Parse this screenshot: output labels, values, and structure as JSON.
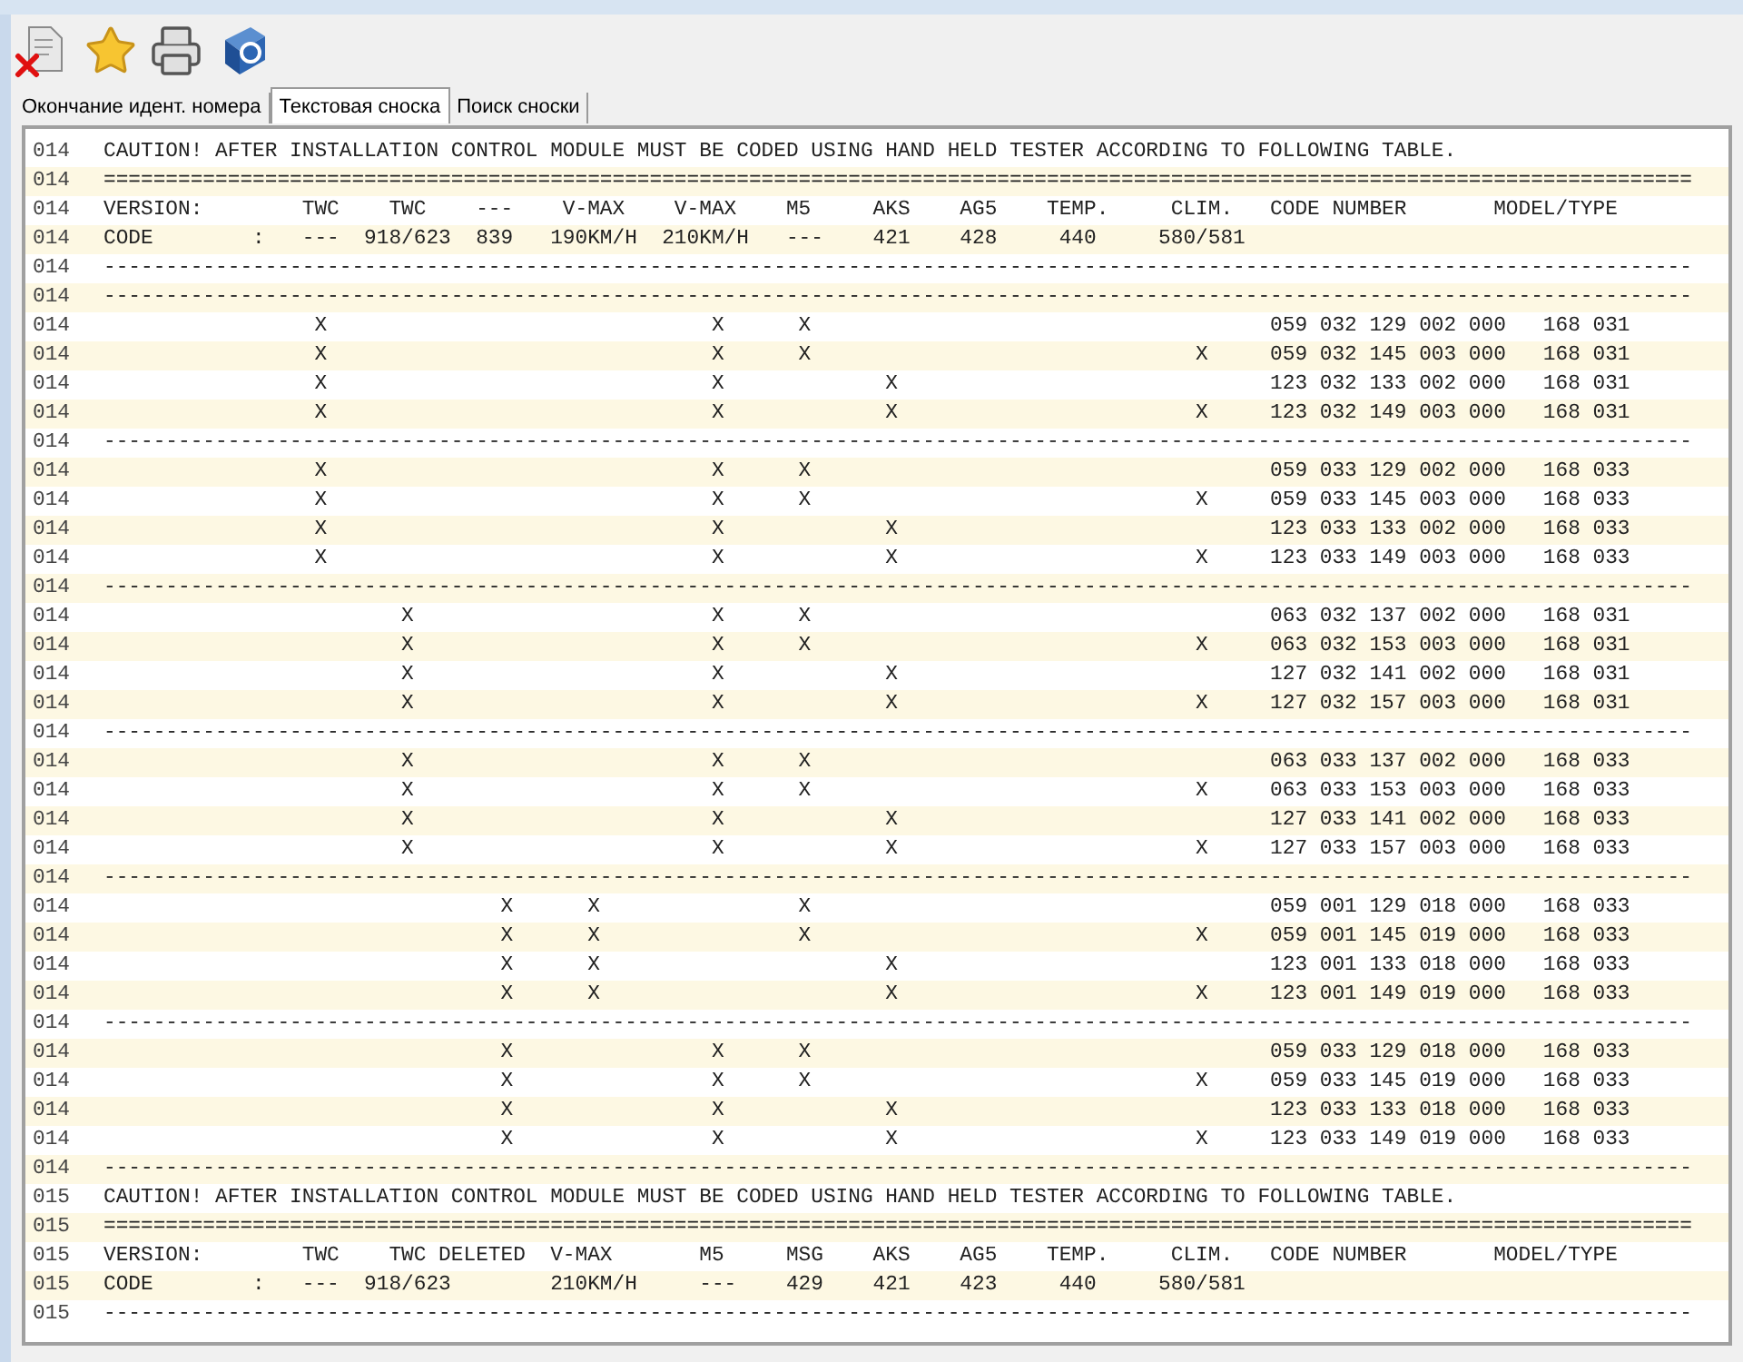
{
  "tabs": [
    {
      "label": "Окончание идент. номера",
      "selected": false
    },
    {
      "label": "Текстовая сноска",
      "selected": true
    },
    {
      "label": "Поиск сноски",
      "selected": false
    }
  ],
  "lines": [
    {
      "num": "014",
      "text": "CAUTION! AFTER INSTALLATION CONTROL MODULE MUST BE CODED USING HAND HELD TESTER ACCORDING TO FOLLOWING TABLE."
    },
    {
      "num": "014",
      "text": "================================================================================================================================"
    },
    {
      "num": "014",
      "text": "VERSION:        TWC    TWC    ---    V-MAX    V-MAX    M5     AKS    AG5    TEMP.     CLIM.   CODE NUMBER       MODEL/TYPE"
    },
    {
      "num": "014",
      "text": "CODE        :   ---  918/623  839   190KM/H  210KM/H   ---    421    428     440     580/581"
    },
    {
      "num": "014",
      "text": "--------------------------------------------------------------------------------------------------------------------------------"
    },
    {
      "num": "014",
      "text": "--------------------------------------------------------------------------------------------------------------------------------"
    },
    {
      "num": "014",
      "text": "                 X                               X      X                                     059 032 129 002 000   168 031"
    },
    {
      "num": "014",
      "text": "                 X                               X      X                               X     059 032 145 003 000   168 031"
    },
    {
      "num": "014",
      "text": "                 X                               X             X                              123 032 133 002 000   168 031"
    },
    {
      "num": "014",
      "text": "                 X                               X             X                        X     123 032 149 003 000   168 031"
    },
    {
      "num": "014",
      "text": "--------------------------------------------------------------------------------------------------------------------------------"
    },
    {
      "num": "014",
      "text": "                 X                               X      X                                     059 033 129 002 000   168 033"
    },
    {
      "num": "014",
      "text": "                 X                               X      X                               X     059 033 145 003 000   168 033"
    },
    {
      "num": "014",
      "text": "                 X                               X             X                              123 033 133 002 000   168 033"
    },
    {
      "num": "014",
      "text": "                 X                               X             X                        X     123 033 149 003 000   168 033"
    },
    {
      "num": "014",
      "text": "--------------------------------------------------------------------------------------------------------------------------------"
    },
    {
      "num": "014",
      "text": "                        X                        X      X                                     063 032 137 002 000   168 031"
    },
    {
      "num": "014",
      "text": "                        X                        X      X                               X     063 032 153 003 000   168 031"
    },
    {
      "num": "014",
      "text": "                        X                        X             X                              127 032 141 002 000   168 031"
    },
    {
      "num": "014",
      "text": "                        X                        X             X                        X     127 032 157 003 000   168 031"
    },
    {
      "num": "014",
      "text": "--------------------------------------------------------------------------------------------------------------------------------"
    },
    {
      "num": "014",
      "text": "                        X                        X      X                                     063 033 137 002 000   168 033"
    },
    {
      "num": "014",
      "text": "                        X                        X      X                               X     063 033 153 003 000   168 033"
    },
    {
      "num": "014",
      "text": "                        X                        X             X                              127 033 141 002 000   168 033"
    },
    {
      "num": "014",
      "text": "                        X                        X             X                        X     127 033 157 003 000   168 033"
    },
    {
      "num": "014",
      "text": "--------------------------------------------------------------------------------------------------------------------------------"
    },
    {
      "num": "014",
      "text": "                                X      X                X                                     059 001 129 018 000   168 033"
    },
    {
      "num": "014",
      "text": "                                X      X                X                               X     059 001 145 019 000   168 033"
    },
    {
      "num": "014",
      "text": "                                X      X                       X                              123 001 133 018 000   168 033"
    },
    {
      "num": "014",
      "text": "                                X      X                       X                        X     123 001 149 019 000   168 033"
    },
    {
      "num": "014",
      "text": "--------------------------------------------------------------------------------------------------------------------------------"
    },
    {
      "num": "014",
      "text": "                                X                X      X                                     059 033 129 018 000   168 033"
    },
    {
      "num": "014",
      "text": "                                X                X      X                               X     059 033 145 019 000   168 033"
    },
    {
      "num": "014",
      "text": "                                X                X             X                              123 033 133 018 000   168 033"
    },
    {
      "num": "014",
      "text": "                                X                X             X                        X     123 033 149 019 000   168 033"
    },
    {
      "num": "014",
      "text": "--------------------------------------------------------------------------------------------------------------------------------"
    },
    {
      "num": "015",
      "text": "CAUTION! AFTER INSTALLATION CONTROL MODULE MUST BE CODED USING HAND HELD TESTER ACCORDING TO FOLLOWING TABLE."
    },
    {
      "num": "015",
      "text": "================================================================================================================================"
    },
    {
      "num": "015",
      "text": "VERSION:        TWC    TWC DELETED  V-MAX       M5     MSG    AKS    AG5    TEMP.     CLIM.   CODE NUMBER       MODEL/TYPE"
    },
    {
      "num": "015",
      "text": "CODE        :   ---  918/623        210KM/H     ---    429    421    423     440     580/581"
    },
    {
      "num": "015",
      "text": "--------------------------------------------------------------------------------------------------------------------------------"
    }
  ]
}
